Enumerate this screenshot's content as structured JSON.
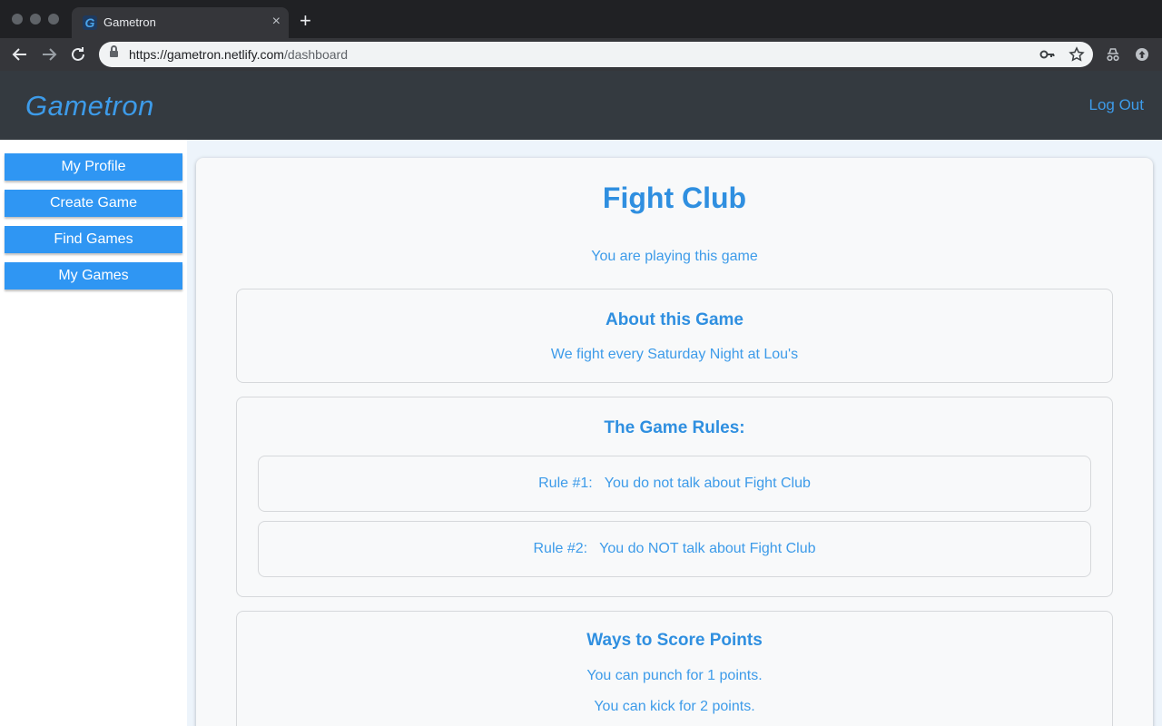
{
  "browser": {
    "tab_title": "Gametron",
    "tab_favicon": "G",
    "tab_close": "×",
    "new_tab": "+",
    "url_host": "https://gametron.netlify.com",
    "url_path": "/dashboard",
    "icons": [
      "back-icon",
      "forward-icon",
      "reload-icon",
      "lock-icon",
      "key-icon",
      "star-icon",
      "incognito-icon",
      "update-icon"
    ]
  },
  "header": {
    "brand": "Gametron",
    "logout": "Log Out",
    "accent_color": "#3d9be9"
  },
  "sidebar": {
    "items": [
      {
        "label": "My Profile"
      },
      {
        "label": "Create Game"
      },
      {
        "label": "Find Games"
      },
      {
        "label": "My Games"
      }
    ],
    "button_color": "#2f96f3"
  },
  "main": {
    "title": "Fight Club",
    "status": "You are playing this game",
    "about": {
      "title": "About this Game",
      "text": "We fight every Saturday Night at Lou's"
    },
    "rules": {
      "title": "The Game Rules:",
      "items": [
        {
          "text": "Rule #1:   You do not talk about Fight Club"
        },
        {
          "text": "Rule #2:   You do NOT talk about Fight Club"
        }
      ]
    },
    "scoring": {
      "title": "Ways to Score Points",
      "items": [
        {
          "text": "You can punch for 1 points."
        },
        {
          "text": "You can kick for 2 points."
        }
      ]
    }
  }
}
